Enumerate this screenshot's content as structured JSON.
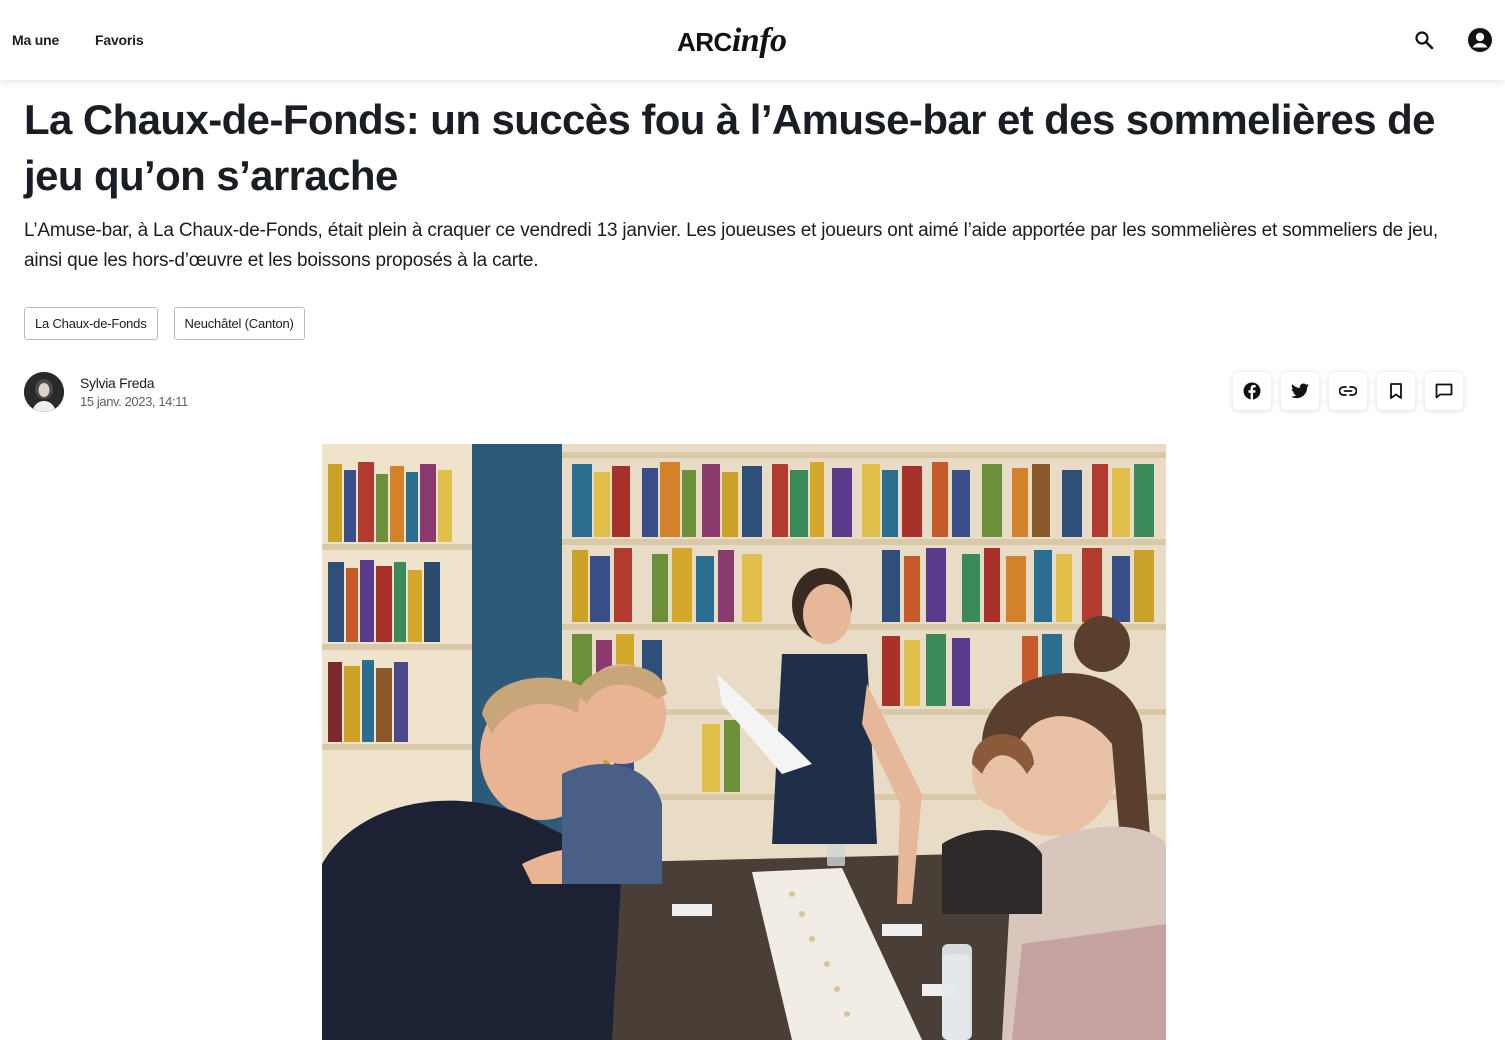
{
  "nav": {
    "items": [
      {
        "label": "Ma une"
      },
      {
        "label": "Favoris"
      }
    ],
    "logo": {
      "part1": "ARC",
      "part2": "info"
    }
  },
  "article": {
    "headline": "La Chaux-de-Fonds: un succès fou à l’Amuse-bar et des sommelières de jeu qu’on s’arrache",
    "lead": "L’Amuse-bar, à La Chaux-de-Fonds, était plein à craquer ce vendredi 13 janvier. Les joueuses et joueurs ont aimé l’aide apportée par les sommelières et sommeliers de jeu, ainsi que les hors-d’œuvre et les boissons proposés à la carte.",
    "tags": [
      {
        "label": "La Chaux-de-Fonds"
      },
      {
        "label": "Neuchâtel (Canton)"
      }
    ],
    "author": {
      "name": "Sylvia Freda",
      "date": "15 janv. 2023, 14:11"
    },
    "share_icons": [
      "facebook-icon",
      "twitter-icon",
      "link-icon",
      "bookmark-icon",
      "comment-icon"
    ]
  }
}
